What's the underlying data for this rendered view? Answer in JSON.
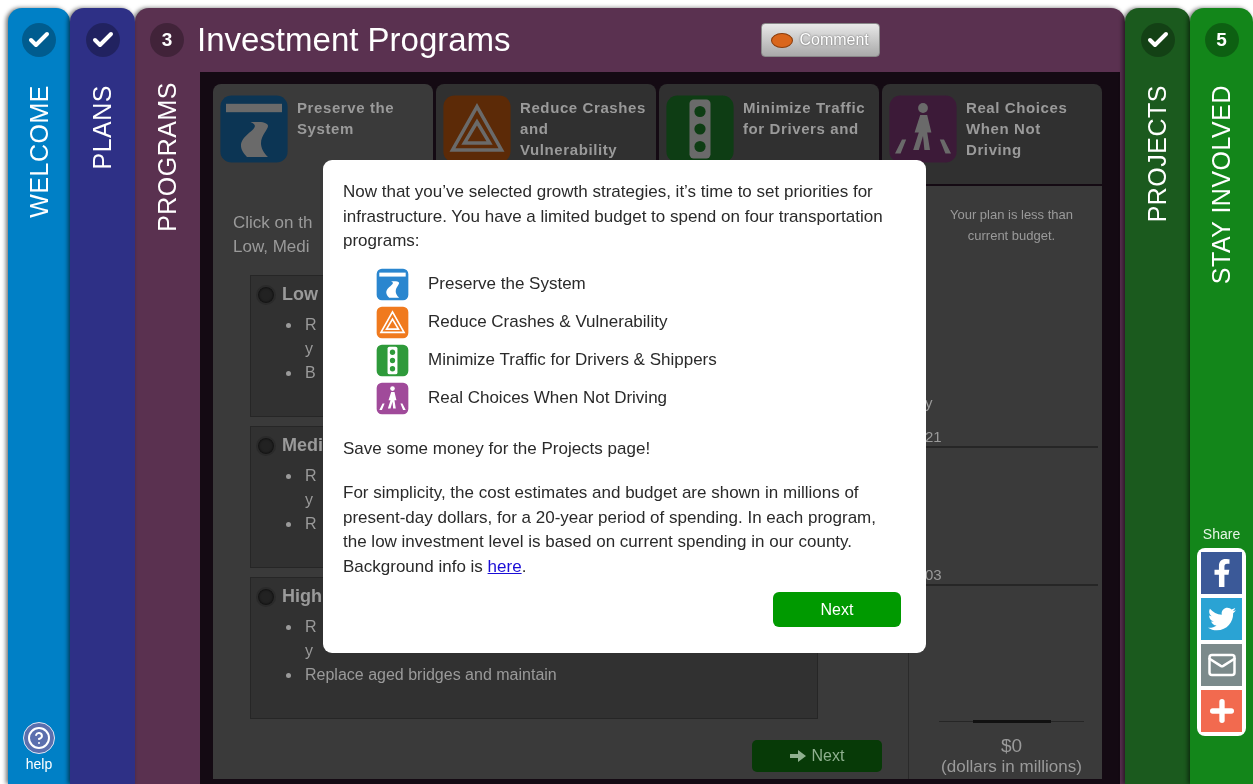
{
  "steps": [
    {
      "label": "WELCOME",
      "done": true,
      "selected": false,
      "color": "#0080c6"
    },
    {
      "label": "PLANS",
      "done": true,
      "selected": false,
      "color": "#2e3086"
    },
    {
      "label": "PROGRAMS",
      "done": false,
      "selected": true,
      "number": "3",
      "color": "#5a3150"
    },
    {
      "label": "PROJECTS",
      "done": true,
      "selected": false,
      "color": "#1b5a1e"
    },
    {
      "label": "STAY INVOLVED",
      "done": false,
      "selected": false,
      "number": "5",
      "color": "#13861a"
    }
  ],
  "help": {
    "label": "help"
  },
  "header": {
    "title": "Investment Programs",
    "comment_button": "Comment"
  },
  "program_tabs": [
    {
      "kind": "preserve",
      "label": "Preserve the System",
      "selected": true
    },
    {
      "kind": "crash",
      "label": "Reduce Crashes and Vulnerability",
      "selected": false
    },
    {
      "kind": "traffic",
      "label": "Minimize Traffic for Drivers and",
      "selected": false
    },
    {
      "kind": "walk",
      "label": "Real Choices When Not Driving",
      "selected": false
    }
  ],
  "instructions": [
    "Click on th",
    "Low, Medi"
  ],
  "levels": [
    {
      "label": "Low",
      "selected": false,
      "lines": [
        {
          "text": "R",
          "bullet": true
        },
        {
          "text": "y",
          "bullet": false
        },
        {
          "text": "B",
          "bullet": true
        }
      ]
    },
    {
      "label": "Medi",
      "selected": false,
      "lines": [
        {
          "text": "R",
          "bullet": true
        },
        {
          "text": "y",
          "bullet": false
        },
        {
          "text": "R",
          "bullet": true
        }
      ]
    },
    {
      "label": "High",
      "selected": false,
      "lines": [
        {
          "text": "R",
          "bullet": true
        },
        {
          "text": "y",
          "bullet": false
        },
        {
          "text": "Replace aged bridges and maintain",
          "bullet": true
        }
      ]
    }
  ],
  "next_button": {
    "label": "Next",
    "disabled": true
  },
  "budget": {
    "message": "Your plan is less than current budget.",
    "fragments": [
      {
        "text": "y",
        "rule": false
      },
      {
        "text": "21",
        "rule": true
      },
      {
        "text": "03",
        "rule": true
      }
    ],
    "total": "$0",
    "unit": "(dollars in millions)"
  },
  "share": {
    "label": "Share",
    "buttons": [
      {
        "kind": "facebook"
      },
      {
        "kind": "twitter"
      },
      {
        "kind": "email"
      },
      {
        "kind": "more"
      }
    ]
  },
  "dialog": {
    "intro": "Now that you’ve selected growth strategies, it’s time to set priorities for infrastructure. You have a limited budget to spend on four transportation programs:",
    "programs": [
      {
        "kind": "preserve",
        "label": "Preserve the System"
      },
      {
        "kind": "crash",
        "label": "Reduce Crashes & Vulnerability"
      },
      {
        "kind": "traffic",
        "label": "Minimize Traffic for Drivers & Shippers"
      },
      {
        "kind": "walk",
        "label": "Real Choices When Not Driving"
      }
    ],
    "note": "Save some money for the Projects page!",
    "details": "For simplicity, the cost estimates and budget are shown in millions of present-day dollars, for a 20-year period of spending. In each program, the low investment level is based on current spending in our county. Background info is ",
    "link": "here",
    "details_end": ".",
    "button": "Next"
  }
}
